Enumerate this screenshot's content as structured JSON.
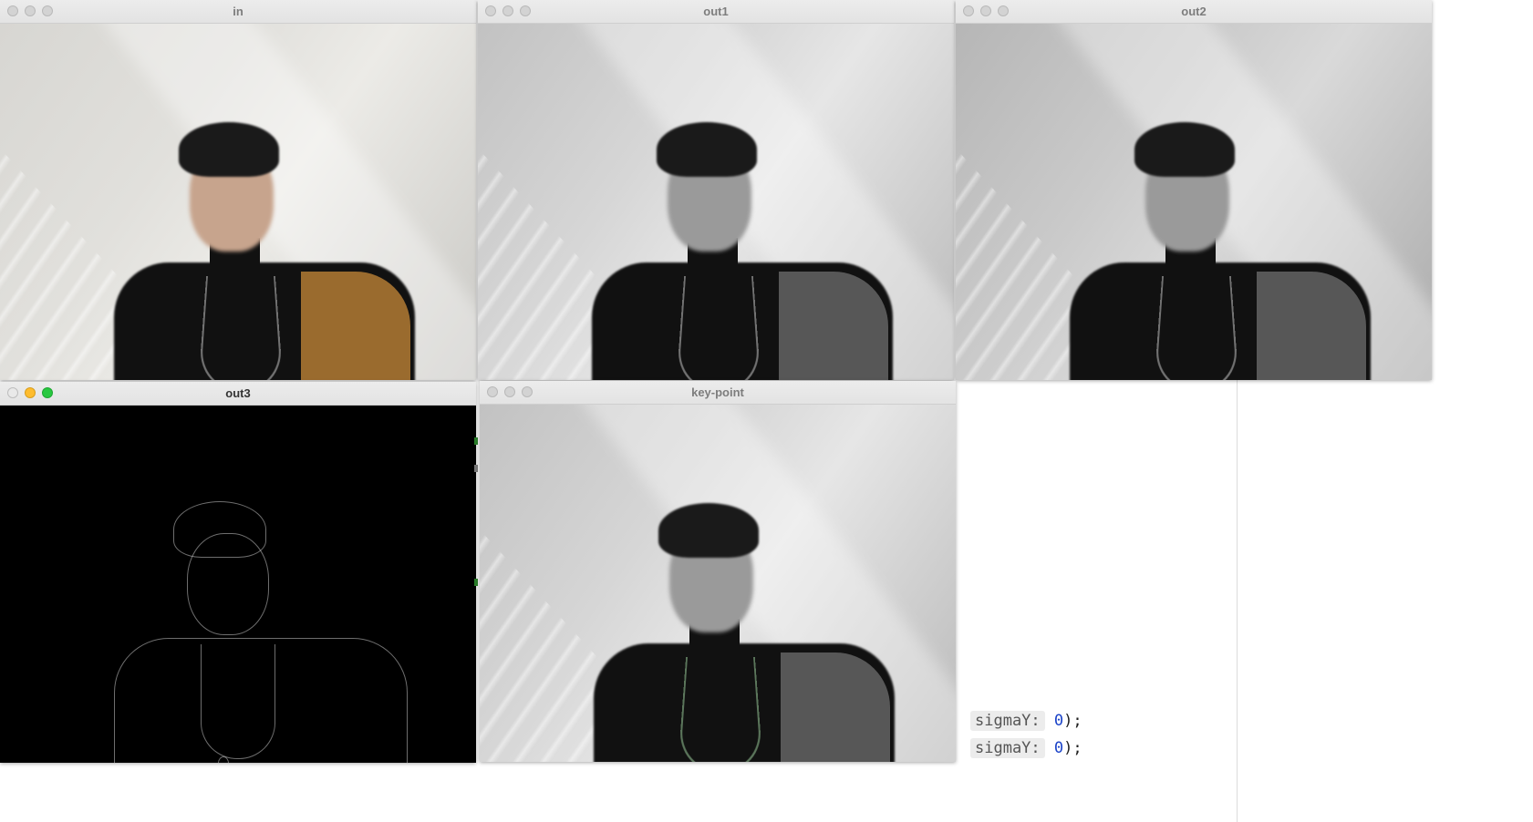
{
  "windows": [
    {
      "id": "in",
      "title": "in",
      "active": false
    },
    {
      "id": "out1",
      "title": "out1",
      "active": false
    },
    {
      "id": "out2",
      "title": "out2",
      "active": false
    },
    {
      "id": "out3",
      "title": "out3",
      "active": true
    },
    {
      "id": "key-point",
      "title": "key-point",
      "active": false
    }
  ],
  "code_editor": {
    "lines": [
      {
        "param_hint": "sigmaY:",
        "value": "0",
        "suffix": ");"
      },
      {
        "param_hint": "sigmaY:",
        "value": "0",
        "suffix": ");"
      }
    ]
  },
  "colors": {
    "close_light": "#e9e9e9",
    "minimize_light": "#febc2e",
    "maximize_light": "#28c840",
    "number_literal": "#1b43c8"
  },
  "icons": [
    "close-light-icon",
    "minimize-light-icon",
    "maximize-light-icon"
  ]
}
